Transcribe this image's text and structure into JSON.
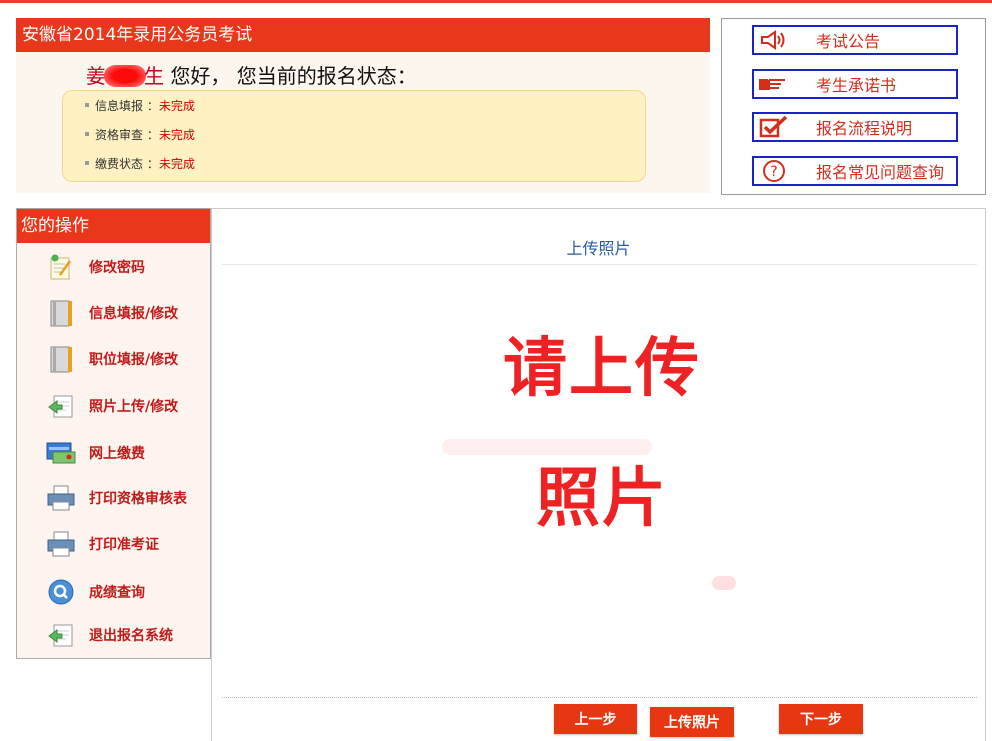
{
  "status": {
    "title": "安徽省2014年录用公务员考试",
    "greeting_name_prefix": "姜",
    "greeting_name_suffix": "生",
    "greeting_text": " 您好， 您当前的报名状态：",
    "rows": [
      {
        "label": "信息填报",
        "sep": " ：",
        "value": "未完成"
      },
      {
        "label": "资格审查",
        "sep": " ：",
        "value": "未完成"
      },
      {
        "label": "缴费状态",
        "sep": " ：",
        "value": "未完成"
      }
    ]
  },
  "quick_links": [
    {
      "label": "考试公告",
      "icon": "speaker-icon"
    },
    {
      "label": "考生承诺书",
      "icon": "pointing-hand-icon"
    },
    {
      "label": "报名流程说明",
      "icon": "checkbox-icon"
    },
    {
      "label": "报名常见问题查询",
      "icon": "question-icon"
    }
  ],
  "sidebar": {
    "title": "您的操作",
    "items": [
      {
        "label": "修改密码",
        "icon": "edit-note-icon"
      },
      {
        "label": "信息填报/修改",
        "icon": "book-icon"
      },
      {
        "label": "职位填报/修改",
        "icon": "book-icon"
      },
      {
        "label": "照片上传/修改",
        "icon": "photo-upload-icon"
      },
      {
        "label": "网上缴费",
        "icon": "payment-card-icon"
      },
      {
        "label": "打印资格审核表",
        "icon": "printer-icon"
      },
      {
        "label": "打印准考证",
        "icon": "printer-icon"
      },
      {
        "label": "成绩查询",
        "icon": "search-icon"
      },
      {
        "label": "退出报名系统",
        "icon": "exit-icon"
      }
    ]
  },
  "main": {
    "title": "上传照片",
    "placeholder_line1": "请上传",
    "placeholder_line2": "照片",
    "buttons": {
      "prev": "上一步",
      "upload": "上传照片",
      "next": "下一步"
    }
  },
  "colors": {
    "accent": "#e8371a",
    "link_border": "#1a22c9",
    "link_text": "#d52d1c",
    "title_blue": "#2a5aa8"
  }
}
